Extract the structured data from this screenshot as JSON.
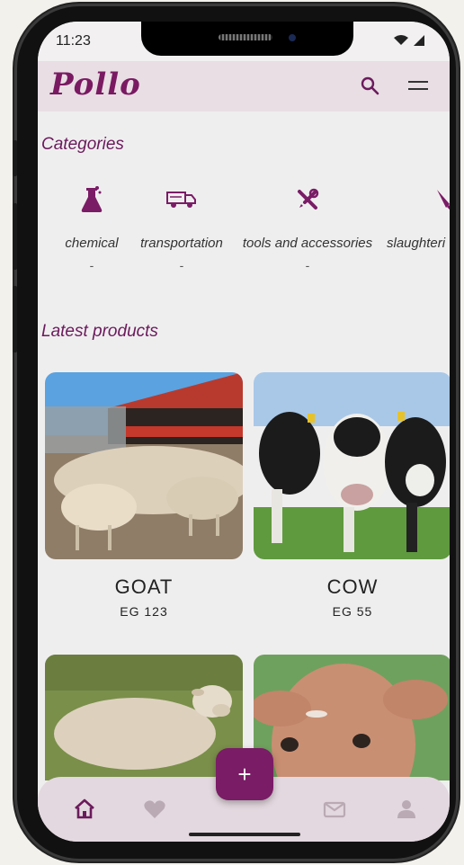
{
  "status": {
    "time": "11:23"
  },
  "app": {
    "logo": "Pollo"
  },
  "sections": {
    "categories": "Categories",
    "latest": "Latest products"
  },
  "categories": [
    {
      "label": "chemical",
      "count": "-",
      "icon": "flask-icon"
    },
    {
      "label": "transportation",
      "count": "-",
      "icon": "truck-icon"
    },
    {
      "label": "tools and accessories",
      "count": "-",
      "icon": "tools-icon"
    },
    {
      "label": "slaughteri",
      "count": "",
      "icon": "knife-icon"
    }
  ],
  "products": [
    {
      "name": "GOAT",
      "price": "EG 123"
    },
    {
      "name": "COW",
      "price": "EG 55"
    },
    {
      "name": "",
      "price": ""
    },
    {
      "name": "",
      "price": ""
    }
  ],
  "fab": {
    "label": "+"
  },
  "colors": {
    "accent": "#7a1c66",
    "appbar": "#e8dee4",
    "nav": "#e3d8df"
  }
}
